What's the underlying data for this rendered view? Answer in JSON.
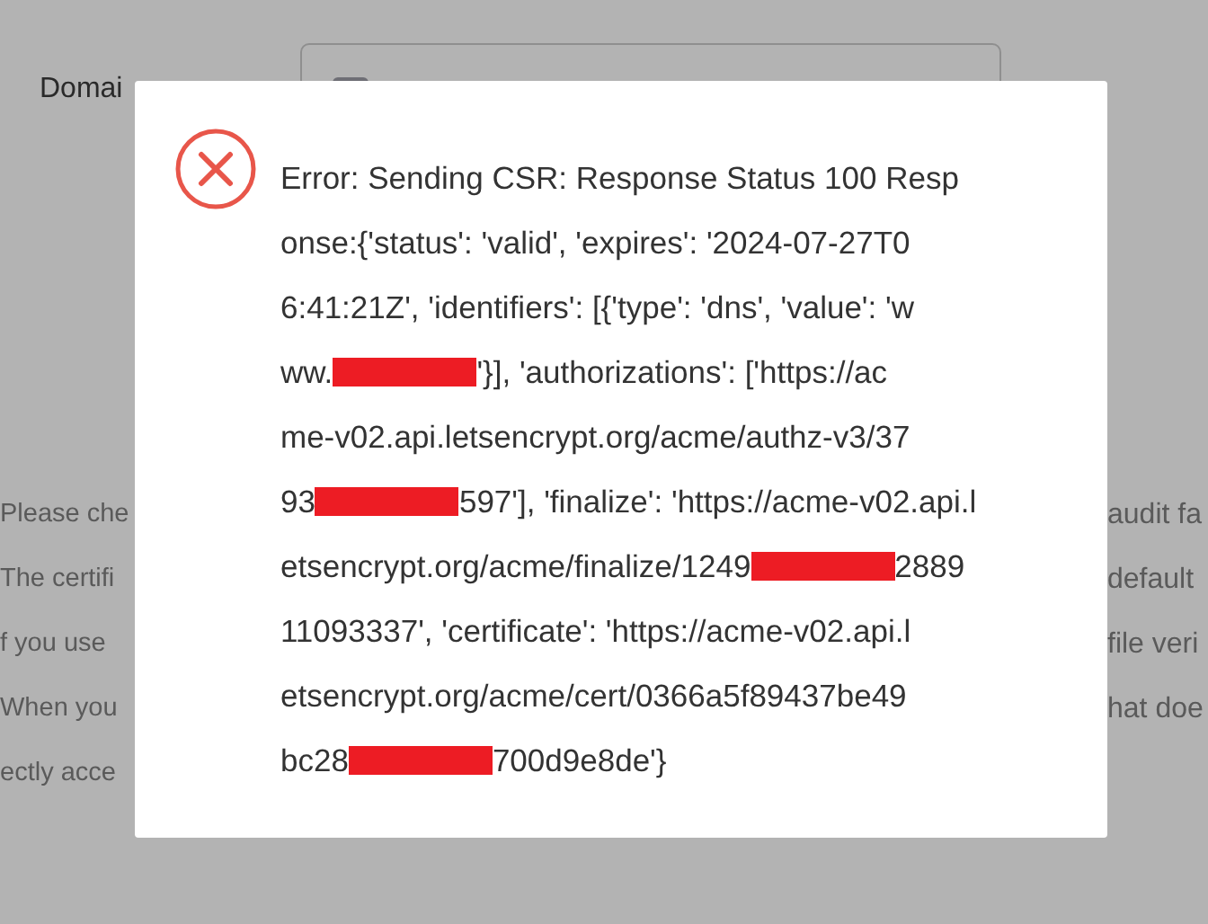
{
  "background": {
    "domain_label": "Domai",
    "notes_left": [
      "Please che",
      "The certifi",
      "f you use",
      "When you",
      "ectly acce"
    ],
    "notes_right": [
      "audit fa",
      "default",
      "file veri",
      "hat doe"
    ]
  },
  "dialog": {
    "lines": [
      [
        {
          "kind": "text",
          "text": "Error: Sending CSR: Response Status 100 Resp"
        }
      ],
      [
        {
          "kind": "text",
          "text": "onse:{'status': 'valid', 'expires': '2024-07-27T0"
        }
      ],
      [
        {
          "kind": "text",
          "text": "6:41:21Z', 'identifiers': [{'type': 'dns', 'value': 'w"
        }
      ],
      [
        {
          "kind": "text",
          "text": "ww."
        },
        {
          "kind": "redaction"
        },
        {
          "kind": "text",
          "text": "'}], 'authorizations': ['https://ac"
        }
      ],
      [
        {
          "kind": "text",
          "text": "me-v02.api.letsencrypt.org/acme/authz-v3/37"
        }
      ],
      [
        {
          "kind": "text",
          "text": "93"
        },
        {
          "kind": "redaction"
        },
        {
          "kind": "text",
          "text": "597'], 'finalize': 'https://acme-v02.api.l"
        }
      ],
      [
        {
          "kind": "text",
          "text": "etsencrypt.org/acme/finalize/1249"
        },
        {
          "kind": "redaction"
        },
        {
          "kind": "text",
          "text": "2889"
        }
      ],
      [
        {
          "kind": "text",
          "text": "11093337', 'certificate': 'https://acme-v02.api.l"
        }
      ],
      [
        {
          "kind": "text",
          "text": "etsencrypt.org/acme/cert/0366a5f89437be49"
        }
      ],
      [
        {
          "kind": "text",
          "text": "bc28"
        },
        {
          "kind": "redaction"
        },
        {
          "kind": "text",
          "text": "700d9e8de'}"
        }
      ]
    ]
  }
}
